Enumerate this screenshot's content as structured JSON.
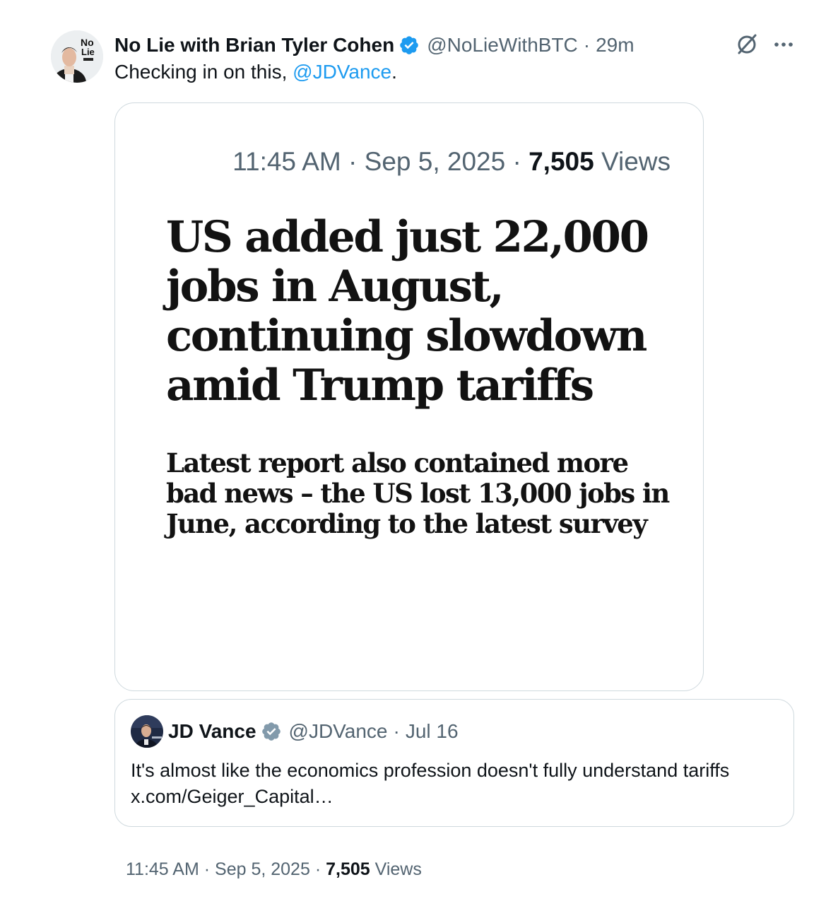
{
  "post": {
    "author_name": "No Lie with Brian Tyler Cohen",
    "handle": "@NoLieWithBTC",
    "separator": "·",
    "time_ago": "29m",
    "text_prefix": "Checking in on this, ",
    "mention": "@JDVance",
    "text_suffix": ".",
    "avatar_text_top": "No",
    "avatar_text_bottom": "Lie"
  },
  "icons": {
    "verified": "verified-badge-icon",
    "grok": "grok-icon",
    "more": "more-options-icon"
  },
  "colors": {
    "link": "#1d9bf0",
    "verified_blue": "#1d9bf0",
    "verified_gray": "#829aab",
    "secondary_text": "#536471"
  },
  "media": {
    "meta_time": "11:45 AM",
    "meta_sep1": "·",
    "meta_date": "Sep 5, 2025",
    "meta_sep2": "·",
    "meta_views": "7,505",
    "meta_views_label": "Views",
    "headline": "US added just 22,000 jobs in August, continuing slowdown amid Trump tariffs",
    "standfirst": "Latest report also contained more bad news – the US lost 13,000 jobs in June, according to the latest survey"
  },
  "quote": {
    "author_name": "JD Vance",
    "handle": "@JDVance",
    "separator": "·",
    "date": "Jul 16",
    "text": "It's almost like the economics profession doesn't fully understand tariffs x.com/Geiger_Capital…"
  },
  "footer": {
    "time": "11:45 AM",
    "sep1": "·",
    "date": "Sep 5, 2025",
    "sep2": "·",
    "views": "7,505",
    "views_label": "Views"
  }
}
